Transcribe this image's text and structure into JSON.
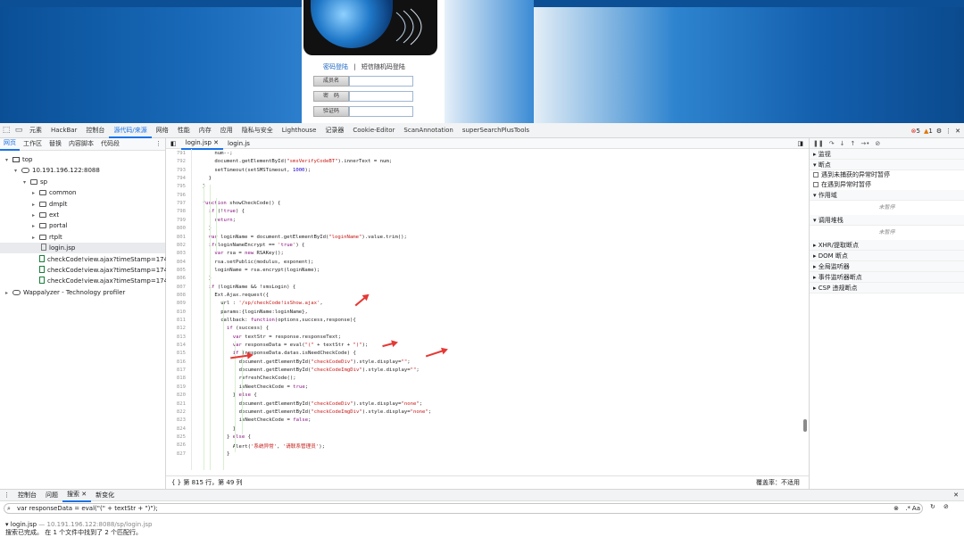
{
  "login": {
    "tab_password": "密码登陆",
    "tab_sep": "|",
    "tab_sms": "短信随机码登陆",
    "field_member": "成员名",
    "field_password": "密　码",
    "field_captcha": "验证码"
  },
  "devtools": {
    "tabs": [
      "元素",
      "HackBar",
      "控制台",
      "源代码/来源",
      "网络",
      "性能",
      "内存",
      "应用",
      "隐私与安全",
      "Lighthouse",
      "记录器",
      "Cookie-Editor",
      "ScanAnnotation",
      "superSearchPlusTools"
    ],
    "active_tab": "源代码/来源",
    "error_count": "5",
    "warning_count": "1"
  },
  "navigator": {
    "tabs": [
      "网页",
      "工作区",
      "替换",
      "内容脚本",
      "代码段"
    ],
    "tree": [
      {
        "label": "top",
        "depth": 0
      },
      {
        "label": "10.191.196.122:8088",
        "depth": 1
      },
      {
        "label": "sp",
        "depth": 2
      },
      {
        "label": "common",
        "depth": 3
      },
      {
        "label": "dmplt",
        "depth": 3
      },
      {
        "label": "ext",
        "depth": 3
      },
      {
        "label": "portal",
        "depth": 3
      },
      {
        "label": "rtplt",
        "depth": 3
      },
      {
        "label": "login.jsp",
        "depth": 3
      },
      {
        "label": "checkCode!view.ajax?timeStamp=1749...",
        "depth": 3
      },
      {
        "label": "checkCode!view.ajax?timeStamp=1749...",
        "depth": 3
      },
      {
        "label": "checkCode!view.ajax?timeStamp=1749...",
        "depth": 3
      },
      {
        "label": "Wappalyzer - Technology profiler",
        "depth": 0
      }
    ]
  },
  "editor": {
    "tabs": [
      "login.jsp",
      "login.js"
    ],
    "status_left": "第 815 行，第 49 列",
    "status_right": "覆盖率：不适用",
    "lines": [
      {
        "n": "791",
        "i": 6,
        "t": "num--;"
      },
      {
        "n": "792",
        "i": 6,
        "t": "document.getElementById(\"smsVerifyCodeBT\").innerText = num;"
      },
      {
        "n": "793",
        "i": 6,
        "t": "setTimeout(setSMSTimeout, 1000);"
      },
      {
        "n": "794",
        "i": 4,
        "t": "}"
      },
      {
        "n": "795",
        "i": 2,
        "t": "}"
      },
      {
        "n": "796",
        "i": 0,
        "t": ""
      },
      {
        "n": "797",
        "i": 2,
        "t": "function showCheckCode() {"
      },
      {
        "n": "798",
        "i": 4,
        "t": "if (!true) {"
      },
      {
        "n": "799",
        "i": 6,
        "t": "return;"
      },
      {
        "n": "800",
        "i": 4,
        "t": "}"
      },
      {
        "n": "801",
        "i": 4,
        "t": "var loginName = document.getElementById(\"loginName\").value.trim();"
      },
      {
        "n": "802",
        "i": 4,
        "t": "if(loginNameEncrypt == 'true') {"
      },
      {
        "n": "803",
        "i": 6,
        "t": "var rsa = new RSAKey();"
      },
      {
        "n": "804",
        "i": 6,
        "t": "rsa.setPublic(modulus, exponent);"
      },
      {
        "n": "805",
        "i": 6,
        "t": "loginName = rsa.encrypt(loginName);"
      },
      {
        "n": "806",
        "i": 4,
        "t": "}"
      },
      {
        "n": "807",
        "i": 4,
        "t": "if (loginName && !smsLogin) {"
      },
      {
        "n": "808",
        "i": 6,
        "t": "Ext.Ajax.request({"
      },
      {
        "n": "809",
        "i": 8,
        "t": "url : '/sp/checkCode!isShow.ajax',"
      },
      {
        "n": "810",
        "i": 8,
        "t": "params:{loginName:loginName},"
      },
      {
        "n": "811",
        "i": 8,
        "t": "callback: function(options,success,response){"
      },
      {
        "n": "812",
        "i": 10,
        "t": "if (success) {"
      },
      {
        "n": "813",
        "i": 12,
        "t": "var textStr = response.responseText;"
      },
      {
        "n": "814",
        "i": 12,
        "t": "var responseData = eval(\"(\" + textStr + \")\");"
      },
      {
        "n": "815",
        "i": 12,
        "t": "if (responseData.datas.isNeedCheckCode) {"
      },
      {
        "n": "816",
        "i": 14,
        "t": "document.getElementById(\"checkCodeDiv\").style.display=\"\";"
      },
      {
        "n": "817",
        "i": 14,
        "t": "document.getElementById(\"checkCodeImgDiv\").style.display=\"\";"
      },
      {
        "n": "818",
        "i": 14,
        "t": "refreshCheckCode();"
      },
      {
        "n": "819",
        "i": 14,
        "t": "isNeetCheckCode = true;"
      },
      {
        "n": "820",
        "i": 12,
        "t": "} else {"
      },
      {
        "n": "821",
        "i": 14,
        "t": "document.getElementById(\"checkCodeDiv\").style.display=\"none\";"
      },
      {
        "n": "822",
        "i": 14,
        "t": "document.getElementById(\"checkCodeImgDiv\").style.display=\"none\";"
      },
      {
        "n": "823",
        "i": 14,
        "t": "isNeetCheckCode = false;"
      },
      {
        "n": "824",
        "i": 12,
        "t": "}"
      },
      {
        "n": "825",
        "i": 10,
        "t": "} else {"
      },
      {
        "n": "826",
        "i": 12,
        "t": "Alert('系统异常', '请联系管理员');"
      },
      {
        "n": "827",
        "i": 10,
        "t": "}"
      }
    ]
  },
  "debugger": {
    "sections": [
      {
        "label": "监视",
        "open": false
      },
      {
        "label": "断点",
        "open": true
      }
    ],
    "checks": [
      "遇到未捕获的异常时暂停",
      "在遇到异常时暂停"
    ],
    "scope_label": "作用域",
    "scope_empty": "未暂停",
    "callstack_label": "调用堆栈",
    "callstack_empty": "未暂停",
    "more_sections": [
      "XHR/提取断点",
      "DOM 断点",
      "全局监听器",
      "事件监听器断点",
      "CSP 违规断点"
    ]
  },
  "drawer": {
    "tabs": [
      "控制台",
      "问题",
      "搜索",
      "新变化"
    ],
    "active_tab": "搜索",
    "search_value": "var responseData = eval(\"(\" + textStr + \")\");",
    "match_case": "Aa",
    "regex": ".*",
    "result_file": "login.jsp",
    "result_path": "— 10.191.196.122:8088/sp/login.jsp",
    "result_summary": "搜索已完成。 在 1 个文件中找到了 2 个匹配行。"
  },
  "colors": {
    "accent": "#1a73e8",
    "arrow": "#e53935",
    "error": "#d93025",
    "warning": "#e37400"
  }
}
